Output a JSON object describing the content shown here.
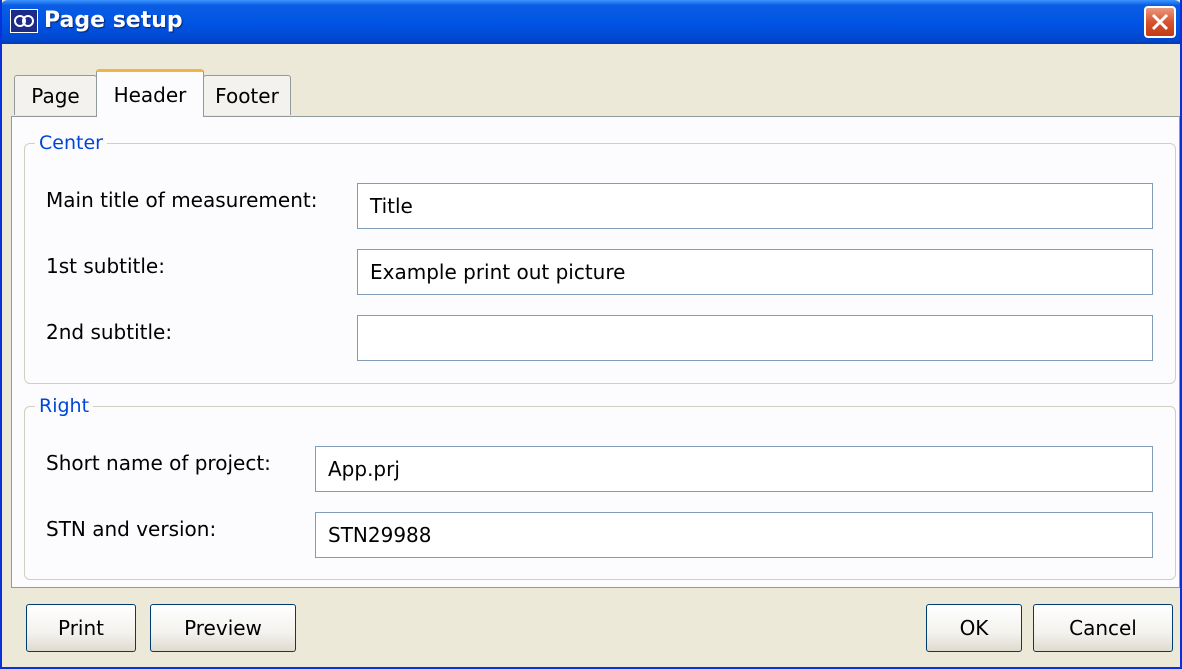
{
  "window": {
    "title": "Page setup",
    "icon": "app-logo-icon",
    "close_icon": "close-icon"
  },
  "tabs": [
    {
      "label": "Page",
      "active": false
    },
    {
      "label": "Header",
      "active": true
    },
    {
      "label": "Footer",
      "active": false
    }
  ],
  "center": {
    "legend": "Center",
    "main_title": {
      "label": "Main title of measurement:",
      "value": "Title"
    },
    "subtitle1": {
      "label": "1st subtitle:",
      "value": "Example print out picture"
    },
    "subtitle2": {
      "label": "2nd subtitle:",
      "value": ""
    }
  },
  "right": {
    "legend": "Right",
    "project": {
      "label": "Short name of project:",
      "value": "App.prj"
    },
    "stn": {
      "label": "STN and version:",
      "value": "STN29988"
    }
  },
  "buttons": {
    "print": "Print",
    "preview": "Preview",
    "ok": "OK",
    "cancel": "Cancel"
  }
}
